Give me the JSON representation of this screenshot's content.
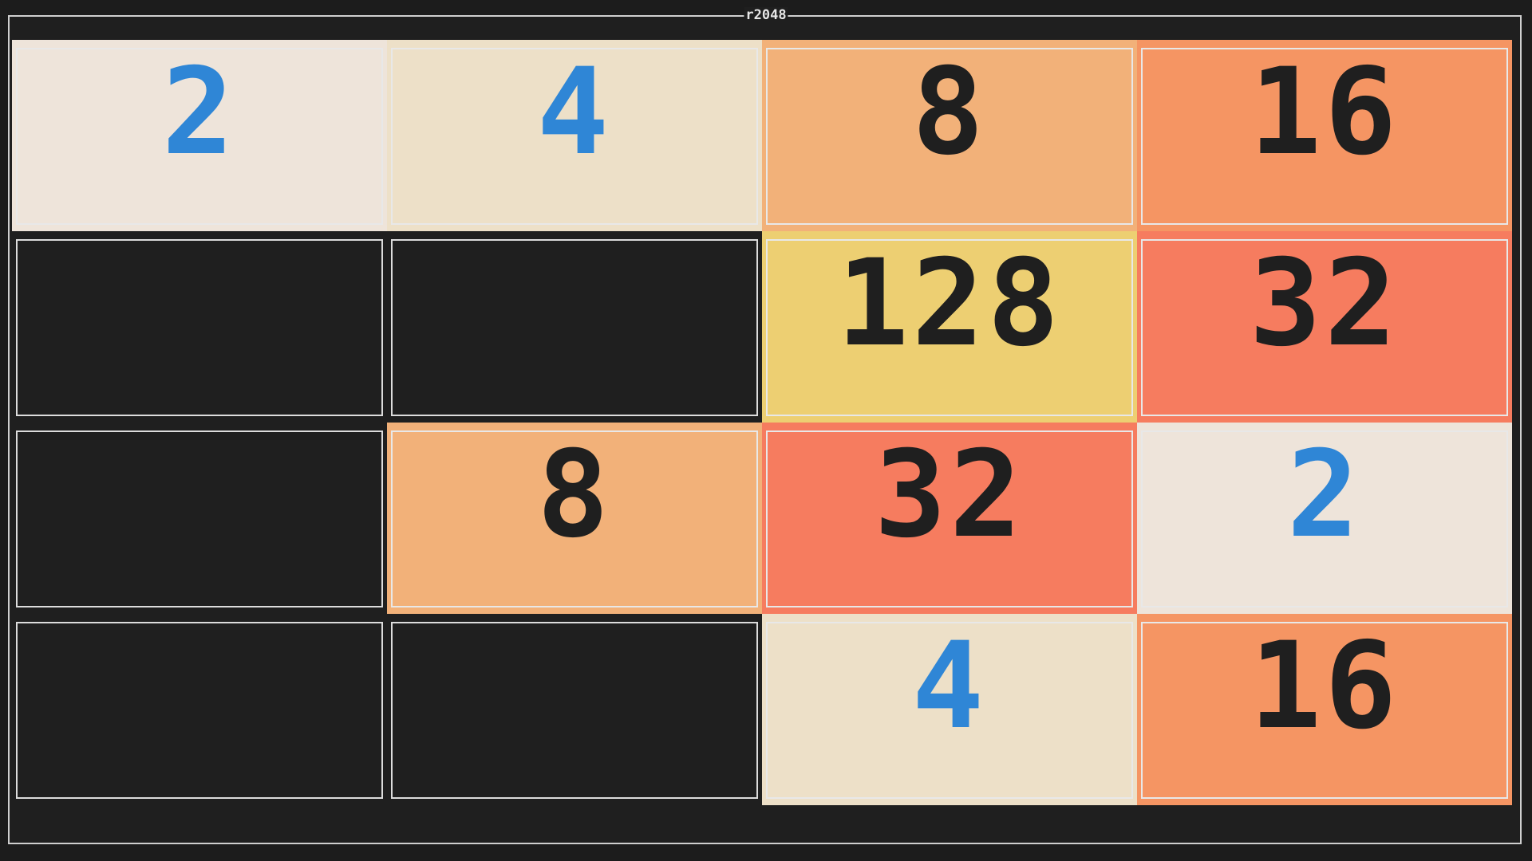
{
  "window": {
    "title": "r2048"
  },
  "colors": {
    "background": "#1f1f1f",
    "border": "#e8e8e8",
    "text_dark": "#1f1f1f",
    "text_blue": "#2f86d6",
    "tile_2": "#eee4da",
    "tile_4": "#ede0c8",
    "tile_8": "#f2b179",
    "tile_16": "#f59563",
    "tile_32": "#f67c5f",
    "tile_128": "#edcf72"
  },
  "board": {
    "rows": [
      [
        {
          "value": "2",
          "bg": "#eee4da",
          "fg": "#2f86d6"
        },
        {
          "value": "4",
          "bg": "#ede0c8",
          "fg": "#2f86d6"
        },
        {
          "value": "8",
          "bg": "#f2b179",
          "fg": "#1f1f1f"
        },
        {
          "value": "16",
          "bg": "#f59563",
          "fg": "#1f1f1f"
        }
      ],
      [
        {
          "value": "",
          "bg": "",
          "fg": ""
        },
        {
          "value": "",
          "bg": "",
          "fg": ""
        },
        {
          "value": "128",
          "bg": "#edcf72",
          "fg": "#1f1f1f"
        },
        {
          "value": "32",
          "bg": "#f67c5f",
          "fg": "#1f1f1f"
        }
      ],
      [
        {
          "value": "",
          "bg": "",
          "fg": ""
        },
        {
          "value": "8",
          "bg": "#f2b179",
          "fg": "#1f1f1f"
        },
        {
          "value": "32",
          "bg": "#f67c5f",
          "fg": "#1f1f1f"
        },
        {
          "value": "2",
          "bg": "#eee4da",
          "fg": "#2f86d6"
        }
      ],
      [
        {
          "value": "",
          "bg": "",
          "fg": ""
        },
        {
          "value": "",
          "bg": "",
          "fg": ""
        },
        {
          "value": "4",
          "bg": "#ede0c8",
          "fg": "#2f86d6"
        },
        {
          "value": "16",
          "bg": "#f59563",
          "fg": "#1f1f1f"
        }
      ]
    ]
  }
}
